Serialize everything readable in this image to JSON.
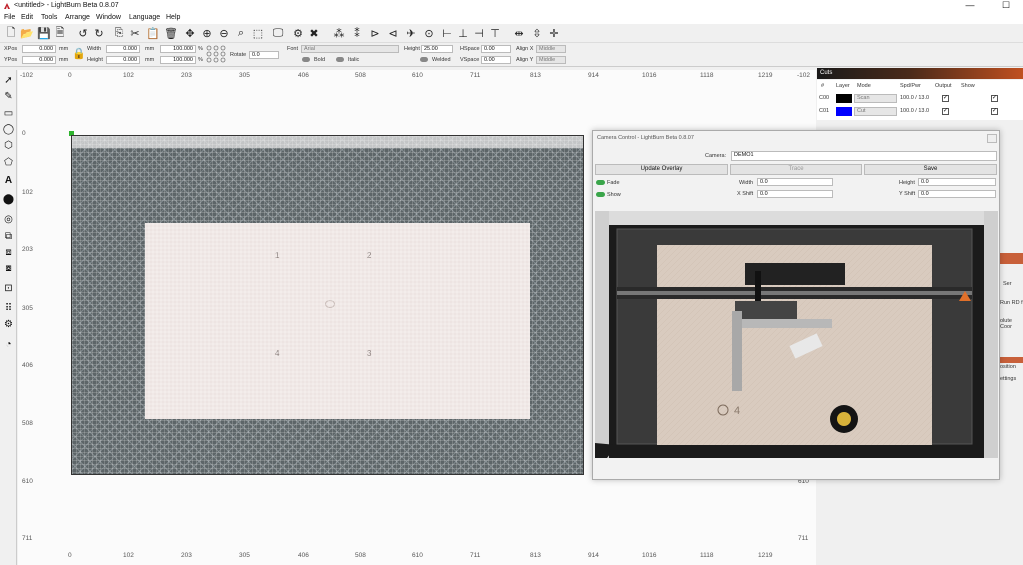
{
  "window": {
    "title": "<untitled> - LightBurn Beta 0.8.07",
    "minimize": "—",
    "maximize": "☐"
  },
  "menu": [
    "File",
    "Edit",
    "Tools",
    "Arrange",
    "Window",
    "Language",
    "Help"
  ],
  "props": {
    "xpos_label": "XPos",
    "xpos": "0.000",
    "ypos_label": "YPos",
    "ypos": "0.000",
    "unit": "mm",
    "width_label": "Width",
    "width": "0.000",
    "height_label": "Height",
    "height": "0.000",
    "scale_w": "100.000",
    "scale_h": "100.000",
    "percent": "%",
    "rotate_label": "Rotate",
    "rotate": "0.0",
    "font_label": "Font",
    "font": "Arial",
    "fheight_label": "Height",
    "fheight": "25.00",
    "hspace_label": "HSpace",
    "hspace": "0.00",
    "vspace_label": "VSpace",
    "vspace": "0.00",
    "alignx_label": "Align X",
    "alignx": "Middle",
    "aligny_label": "Align Y",
    "aligny": "Middle",
    "bold": "Bold",
    "italic": "Italic",
    "welded": "Welded"
  },
  "ruler": {
    "top": [
      "-102",
      "0",
      "102",
      "203",
      "305",
      "406",
      "508",
      "610",
      "711",
      "813",
      "914",
      "1016",
      "1118",
      "1219",
      "-102"
    ],
    "bottom": [
      "0",
      "102",
      "203",
      "305",
      "406",
      "508",
      "610",
      "711",
      "813",
      "914",
      "1016",
      "1118",
      "1219"
    ],
    "left": [
      "0",
      "102",
      "203",
      "305",
      "406",
      "508",
      "610",
      "711"
    ],
    "right": [
      "610",
      "711"
    ]
  },
  "bed_markers": [
    "1",
    "2",
    "4",
    "3"
  ],
  "cuts": {
    "title": "Cuts",
    "headers": [
      "#",
      "Layer",
      "Mode",
      "Spd/Pwr",
      "Output",
      "Show"
    ],
    "rows": [
      {
        "id": "C00",
        "color": "#000000",
        "mode": "Scan",
        "spdpwr": "100.0 / 13.0"
      },
      {
        "id": "C01",
        "color": "#0000ff",
        "mode": "Cut",
        "spdpwr": "100.0 / 13.0"
      }
    ]
  },
  "side_fragments": [
    "Ser",
    "Run RD f",
    "olute Coor",
    "osition",
    "ettings"
  ],
  "camera": {
    "title": "Camera Control - LightBurn Beta 0.8.07",
    "camera_label": "Camera:",
    "camera_value": "DEMO1",
    "update_overlay": "Update Overlay",
    "trace": "Trace",
    "save": "Save",
    "fade": "Fade",
    "show": "Show",
    "width_label": "Width",
    "width": "0.0",
    "xshift_label": "X Shift",
    "xshift": "0.0",
    "height_label": "Height",
    "height": "0.0",
    "yshift_label": "Y Shift",
    "yshift": "0.0",
    "pic_marker": "4"
  }
}
